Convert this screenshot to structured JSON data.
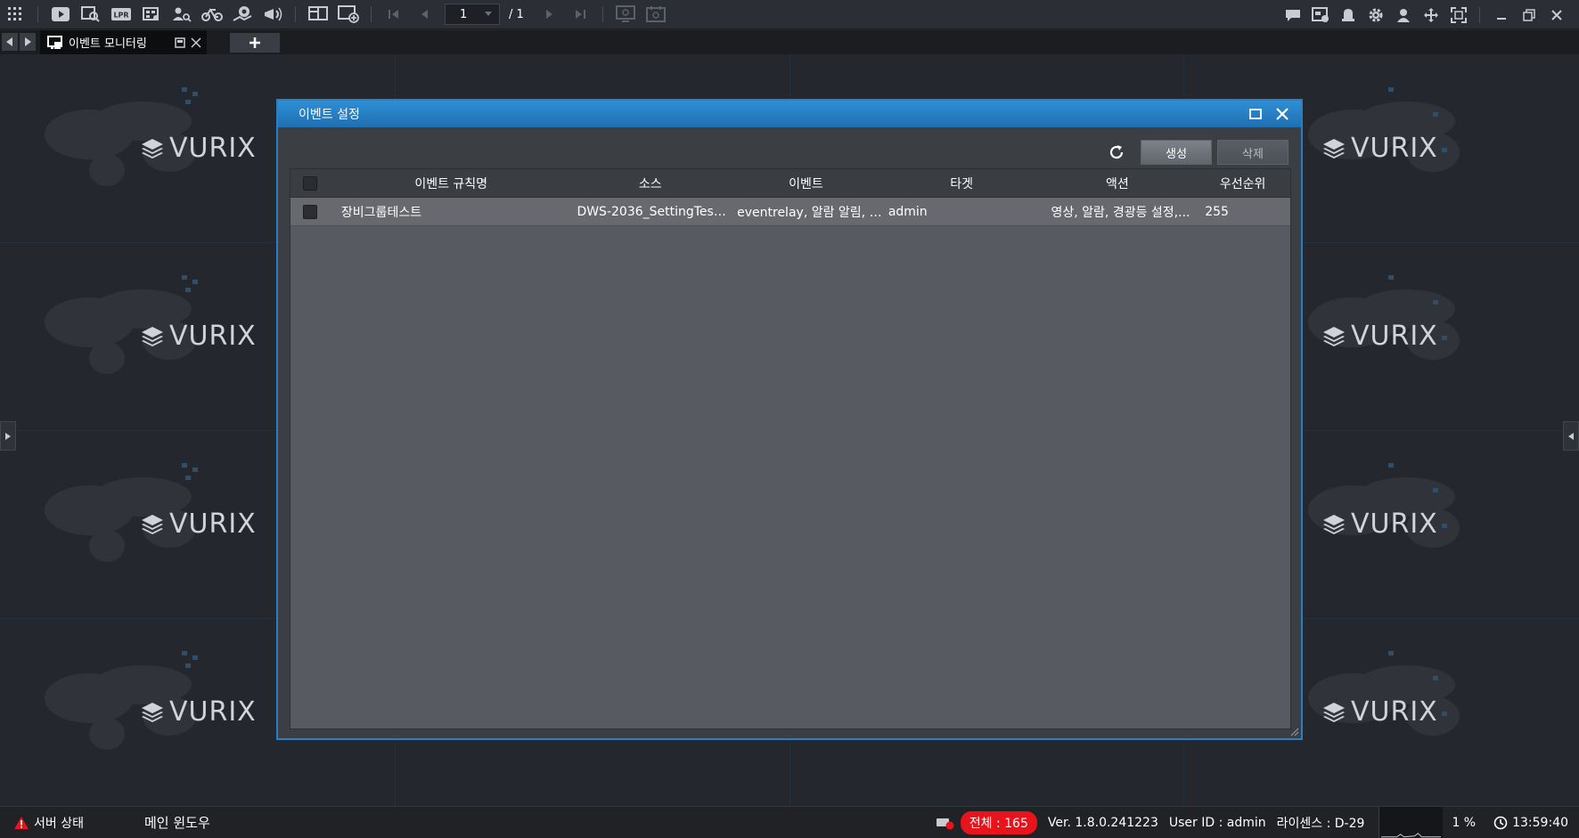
{
  "toolbar": {
    "page_current": "1",
    "page_total": "/ 1"
  },
  "tab": {
    "title": "이벤트 모니터링"
  },
  "workspace": {
    "logo_text": "VURIX"
  },
  "dialog": {
    "title": "이벤트 설정",
    "create_label": "생성",
    "delete_label": "삭제",
    "columns": {
      "name": "이벤트 규칙명",
      "source": "소스",
      "event": "이벤트",
      "target": "타겟",
      "action": "액션",
      "priority": "우선순위"
    },
    "rows": [
      {
        "name": "장비그룹테스트",
        "source": "DWS-2036_SettingTest,...",
        "event": "eventrelay, 알람 알림, 비...",
        "target": "admin",
        "action": "영상, 알람, 경광등 설정,...",
        "priority": "255"
      }
    ]
  },
  "status": {
    "server_label": "서버 상태",
    "window_label": "메인 윈도우",
    "total_badge": "전체 : 165",
    "version": "Ver. 1.8.0.241223",
    "user": "User ID : admin",
    "license": "라이센스 : D-29",
    "cpu": "1 %",
    "time": "13:59:40"
  },
  "colors": {
    "accent": "#2a7fc2",
    "alert": "#e8141c",
    "background": "#24272d"
  },
  "icons": [
    "grid-menu-icon",
    "play-icon",
    "search-playback-icon",
    "lpr-icon",
    "camera-list-icon",
    "person-search-icon",
    "bike-icon",
    "map-pin-icon",
    "megaphone-icon",
    "layout-icon",
    "add-screen-icon",
    "first-page-icon",
    "prev-page-icon",
    "next-page-icon",
    "last-page-icon",
    "monitor-icon",
    "calendar-monitor-icon",
    "chat-icon",
    "event-window-icon",
    "alarm-icon",
    "gear-icon",
    "user-icon",
    "move-icon",
    "fullscreen-icon",
    "minimize-icon",
    "restore-icon",
    "close-icon"
  ]
}
